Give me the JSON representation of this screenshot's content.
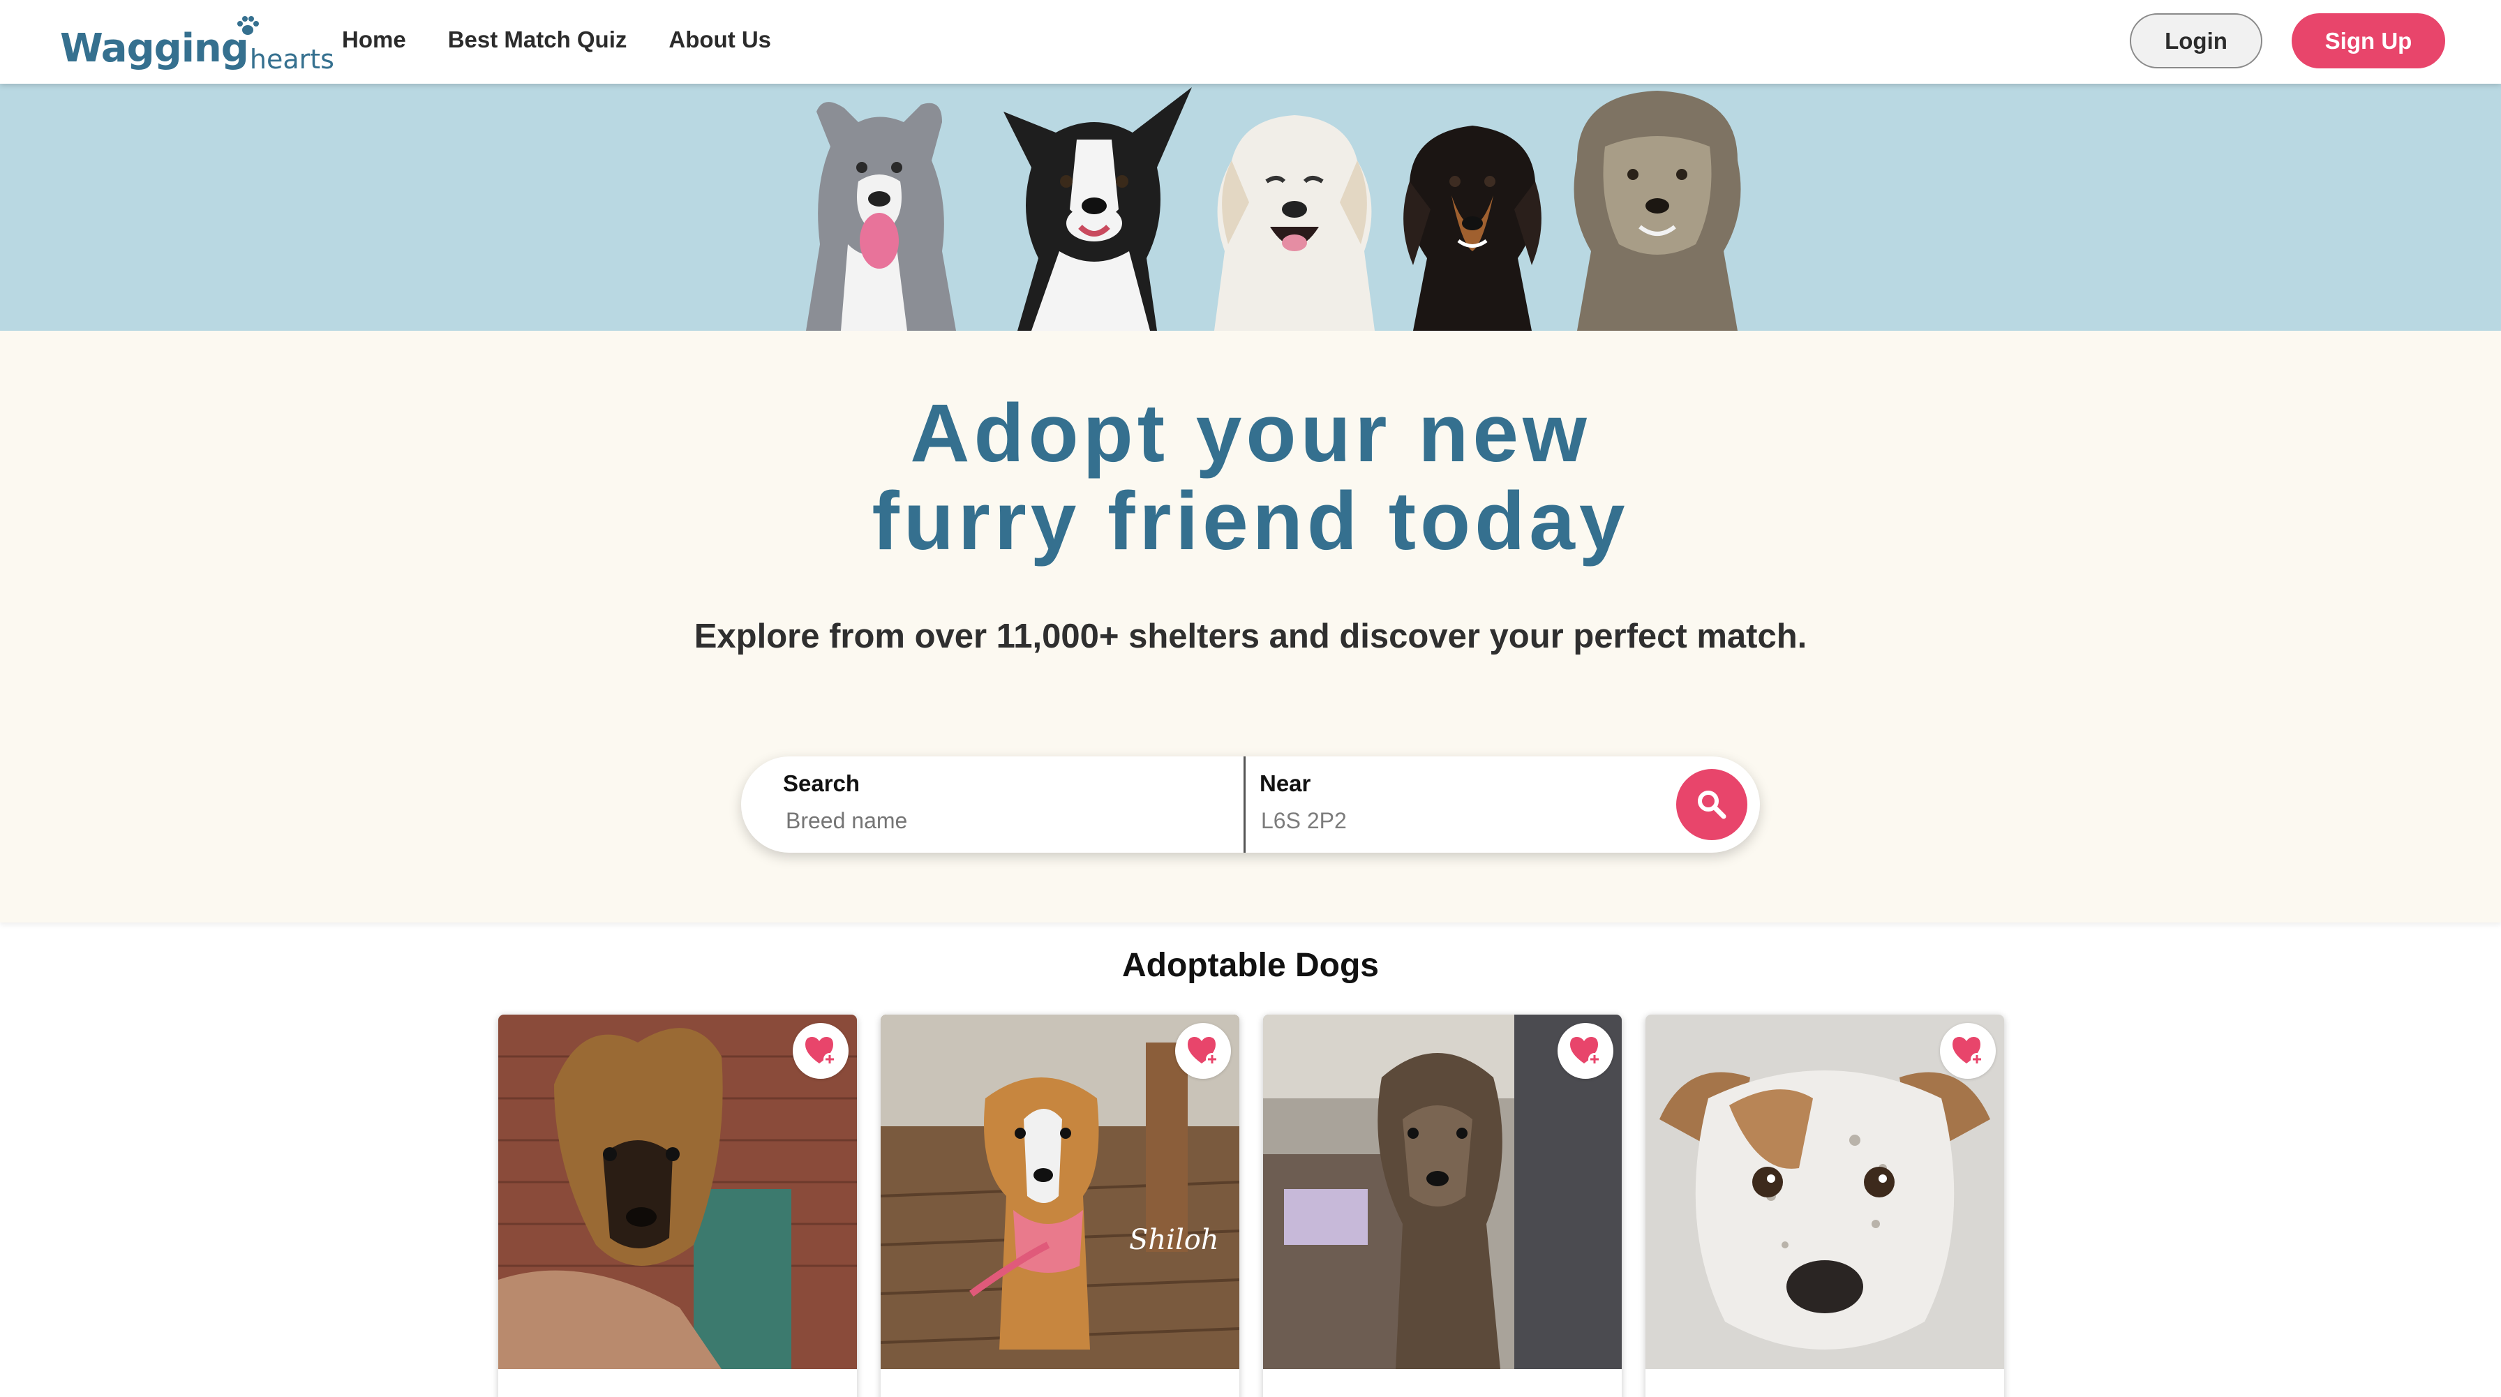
{
  "header": {
    "logo_main": "Wagging",
    "logo_sub": "hearts",
    "nav": [
      "Home",
      "Best Match Quiz",
      "About Us"
    ],
    "login_label": "Login",
    "signup_label": "Sign Up"
  },
  "hero": {
    "title_line1": "Adopt your new",
    "title_line2": "furry friend today",
    "subtitle": "Explore from over 11,000+ shelters and discover your perfect match."
  },
  "search": {
    "search_label": "Search",
    "search_placeholder": "Breed name",
    "near_label": "Near",
    "near_value": "L6S 2P2",
    "button_icon": "search-icon"
  },
  "section": {
    "title": "Adoptable Dogs"
  },
  "cards": [
    {
      "caption": "",
      "icon": "heart-plus-icon"
    },
    {
      "caption": "Shiloh",
      "icon": "heart-plus-icon"
    },
    {
      "caption": "",
      "icon": "heart-plus-icon"
    },
    {
      "caption": "",
      "icon": "heart-plus-icon"
    }
  ],
  "colors": {
    "brand_blue": "#35708f",
    "accent_pink": "#e8456b",
    "banner_bg": "#b9d8e2",
    "hero_bg": "#fcf9f1"
  }
}
